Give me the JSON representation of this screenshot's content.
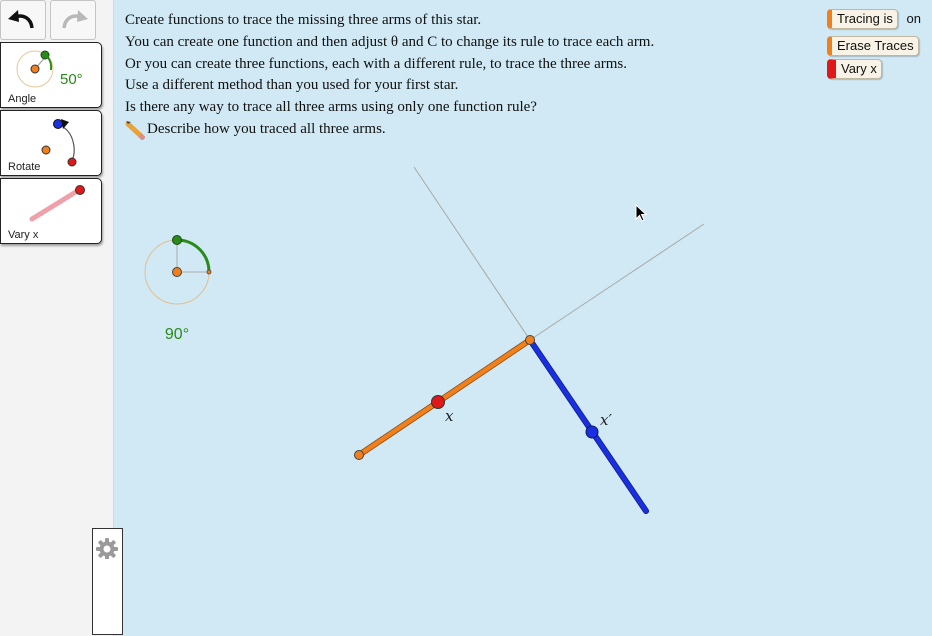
{
  "toolbar": {
    "undo_icon": "undo-arrow-icon",
    "redo_icon": "redo-arrow-icon"
  },
  "tools": [
    {
      "label": "Angle",
      "value": "50°"
    },
    {
      "label": "Rotate"
    },
    {
      "label": "Vary x"
    }
  ],
  "instructions": [
    "Create functions to trace the missing three arms of this star.",
    "You can create one function and then adjust θ and C to change its rule to trace each arm.",
    "Or you can create three functions, each with a different rule, to trace the three arms.",
    "Use a different method than you used for your first star.",
    "Is there any way to trace all three arms using only one function rule?",
    "Describe how you traced all three arms."
  ],
  "controls": {
    "tracing_label": "Tracing is",
    "tracing_state": "on",
    "erase_label": "Erase Traces",
    "vary_label": "Vary x"
  },
  "canvas": {
    "angle_value": "90°",
    "label_x": "x",
    "label_xprime": "x′"
  },
  "colors": {
    "background": "#d0e9f4",
    "orange": "#f07f1d",
    "blue": "#1a2fe0",
    "red": "#e01818",
    "green": "#2a8a1a"
  }
}
